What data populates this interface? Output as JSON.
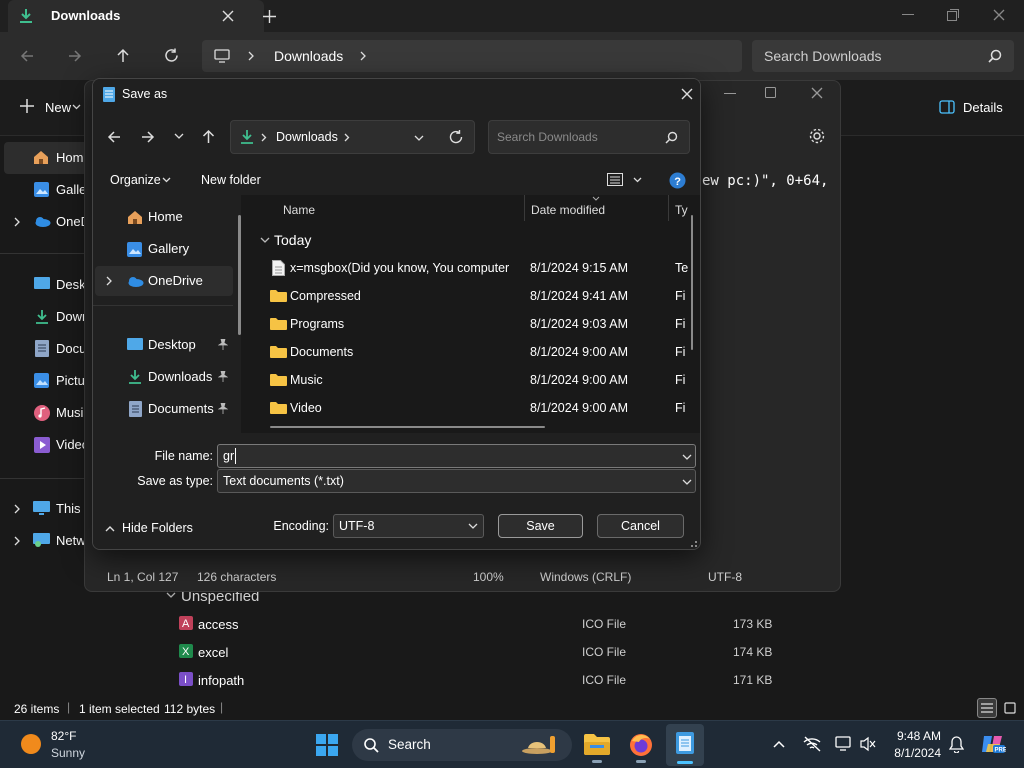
{
  "explorer": {
    "tab_title": "Downloads",
    "breadcrumb": "Downloads",
    "search_placeholder": "Search Downloads",
    "new_label": "New",
    "details_label": "Details",
    "nav_items": [
      "Home",
      "Gallery",
      "OneDrive",
      "Desktop",
      "Downloads",
      "Documents",
      "Pictures",
      "Music",
      "Videos",
      "This PC",
      "Network"
    ],
    "group_label": "Unspecified",
    "files": [
      {
        "name": "access",
        "type": "ICO File",
        "size": "173 KB"
      },
      {
        "name": "excel",
        "type": "ICO File",
        "size": "174 KB"
      },
      {
        "name": "infopath",
        "type": "ICO File",
        "size": "171 KB"
      }
    ],
    "status": {
      "items": "26 items",
      "selected": "1 item selected",
      "size": "112 bytes"
    }
  },
  "notepad": {
    "code_text": "ew pc:)\", 0+64,",
    "status": {
      "position": "Ln 1, Col 127",
      "chars": "126 characters",
      "zoom": "100%",
      "line_ending": "Windows (CRLF)",
      "encoding": "UTF-8"
    }
  },
  "dialog": {
    "title": "Save as",
    "address": "Downloads",
    "search_placeholder": "Search Downloads",
    "organize_label": "Organize",
    "new_folder_label": "New folder",
    "sidebar": [
      {
        "label": "Home",
        "icon": "home-icon"
      },
      {
        "label": "Gallery",
        "icon": "gallery-icon"
      },
      {
        "label": "OneDrive",
        "icon": "cloud-icon"
      },
      {
        "label": "Desktop",
        "icon": "desktop-icon"
      },
      {
        "label": "Downloads",
        "icon": "download-icon"
      },
      {
        "label": "Documents",
        "icon": "documents-icon"
      }
    ],
    "columns": {
      "name": "Name",
      "date": "Date modified",
      "type": "Ty"
    },
    "group": "Today",
    "files": [
      {
        "name": "x=msgbox(Did you know, You computer",
        "date": "8/1/2024 9:15 AM",
        "type": "Te",
        "kind": "text"
      },
      {
        "name": "Compressed",
        "date": "8/1/2024 9:41 AM",
        "type": "Fi",
        "kind": "folder"
      },
      {
        "name": "Programs",
        "date": "8/1/2024 9:03 AM",
        "type": "Fi",
        "kind": "folder"
      },
      {
        "name": "Documents",
        "date": "8/1/2024 9:00 AM",
        "type": "Fi",
        "kind": "folder"
      },
      {
        "name": "Music",
        "date": "8/1/2024 9:00 AM",
        "type": "Fi",
        "kind": "folder"
      },
      {
        "name": "Video",
        "date": "8/1/2024 9:00 AM",
        "type": "Fi",
        "kind": "folder"
      }
    ],
    "file_name_label": "File name:",
    "file_name_value": "gr",
    "save_type_label": "Save as type:",
    "save_type_value": "Text documents (*.txt)",
    "hide_folders_label": "Hide Folders",
    "encoding_label": "Encoding:",
    "encoding_value": "UTF-8",
    "save_label": "Save",
    "cancel_label": "Cancel"
  },
  "taskbar": {
    "weather_temp": "82°F",
    "weather_desc": "Sunny",
    "search_label": "Search",
    "time": "9:48 AM",
    "date": "8/1/2024"
  },
  "colors": {
    "accent": "#4cc2ff",
    "folder": "#f6c344",
    "download": "#3fbf8f"
  }
}
